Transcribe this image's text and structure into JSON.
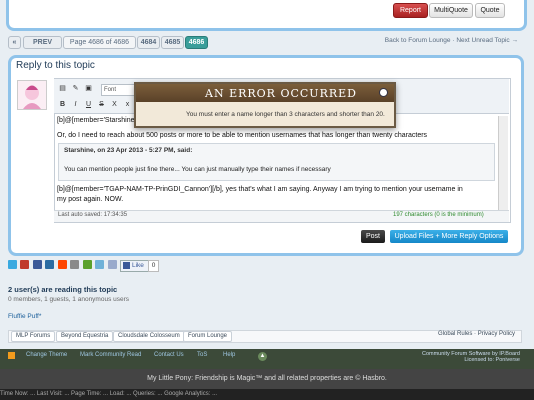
{
  "post_buttons": {
    "report": "Report",
    "multiquote": "MultiQuote",
    "quote": "Quote"
  },
  "pagination": {
    "prev": "PREV",
    "page_of": "Page 4686 of 4686",
    "pages": [
      "4684",
      "4685",
      "4686"
    ]
  },
  "topic_nav": {
    "back": "Back to Forum Lounge",
    "separator": "·",
    "next": "Next Unread Topic →"
  },
  "reply": {
    "title": "Reply to this topic",
    "font_label": "Font",
    "lines": [
      "[b]@[member='Starshine']",
      "Or, do I need to reach about 500 posts or more to be able to mention usernames that has longer than twenty characters",
      "[b]@[member='TGAP-NAM-TP-PrinGDI_Cannon'][/b], yes that's what I am saying. Anyway I am trying to mention your username in",
      "my post again. NOW."
    ],
    "quote_head": "Starshine, on 23 Apr 2013 - 5:27 PM, said:",
    "quote_body": "You can mention people just fine there... You can just manually type their names if necessary",
    "autosave": "Last auto saved: 17:34:35",
    "char_count": "197 characters (0 is the minimum)",
    "post_button": "Post",
    "upload_button": "Upload Files + More Reply Options"
  },
  "error": {
    "title": "AN ERROR OCCURRED",
    "message": "You must enter a name longer than 3 characters and shorter than 20."
  },
  "share": {
    "like_label": "Like",
    "like_count": "0"
  },
  "reading": {
    "title": "2 user(s) are reading this topic",
    "counts": "0 members, 1 guests, 1 anonymous users",
    "user": "Fluffie Puff*"
  },
  "breadcrumb": [
    "MLP Forums",
    "Beyond Equestria",
    "Cloudsdale Colosseum",
    "Forum Lounge"
  ],
  "footer_right_links": {
    "rules": "Global Rules",
    "separator": "·",
    "privacy": "Privacy Policy"
  },
  "footer": {
    "links": [
      "Change Theme",
      "Mark Community Read",
      "Contact Us",
      "ToS",
      "Help"
    ],
    "software": "Community Forum Software by IP.Board",
    "licensed": "Licensed to: Poniverse",
    "copyright": "My Little Pony: Friendship is Magic™ and all related properties are © Hasbro.",
    "bottom": "Time Now: ...      Last Visit: ...      Page Time: ...      Load: ...      Queries: ...      Google Analytics: ..."
  }
}
